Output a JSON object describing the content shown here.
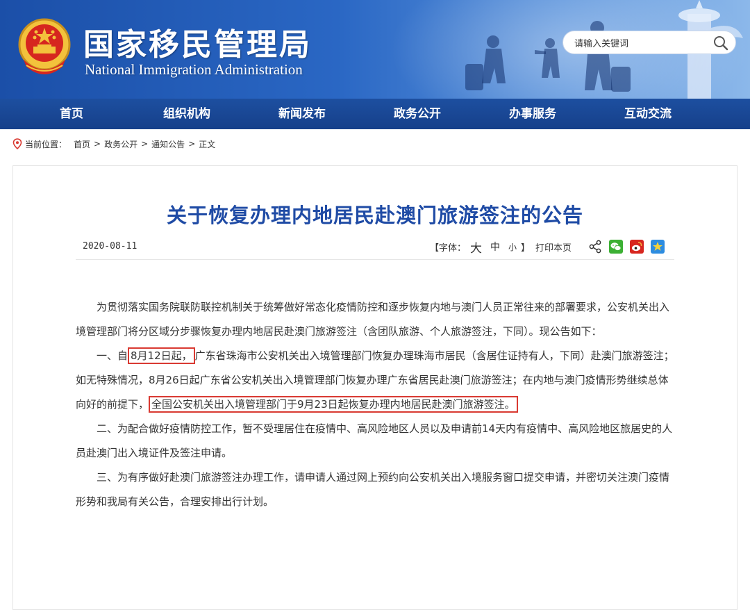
{
  "header": {
    "title": "国家移民管理局",
    "subtitle": "National Immigration Administration",
    "search_placeholder": "请输入关键词",
    "brand_color": "#1d4fa0",
    "emblem_icon": "national-emblem-icon"
  },
  "nav": {
    "items": [
      {
        "label": "首页"
      },
      {
        "label": "组织机构"
      },
      {
        "label": "新闻发布"
      },
      {
        "label": "政务公开"
      },
      {
        "label": "办事服务"
      },
      {
        "label": "互动交流"
      }
    ]
  },
  "breadcrumb": {
    "prefix": "当前位置：",
    "items": [
      {
        "label": "首页"
      },
      {
        "label": "政务公开"
      },
      {
        "label": "通知公告"
      },
      {
        "label": "正文"
      }
    ],
    "separator": ">"
  },
  "article": {
    "title": "关于恢复办理内地居民赴澳门旅游签注的公告",
    "date": "2020-08-11",
    "font_label_open": "【字体：",
    "font_big": "大",
    "font_mid": "中",
    "font_small": "小",
    "font_label_close": "】",
    "print_label": "打印本页",
    "share_icons": [
      "share-icon",
      "wechat-icon",
      "weibo-icon",
      "qzone-icon"
    ],
    "title_color": "#1f4ba5",
    "highlight_color": "#d93a32",
    "p1": "为贯彻落实国务院联防联控机制关于统筹做好常态化疫情防控和逐步恢复内地与澳门人员正常往来的部署要求，公安机关出入境管理部门将分区域分步骤恢复办理内地居民赴澳门旅游签注（含团队旅游、个人旅游签注，下同）。现公告如下：",
    "p2_a": "一、自",
    "p2_hl1": "8月12日起，",
    "p2_b": "广东省珠海市公安机关出入境管理部门恢复办理珠海市居民（含居住证持有人，下同）赴澳门旅游签注；如无特殊情况，8月26日起广东省公安机关出入境管理部门恢复办理广东省居民赴澳门旅游签注；在内地与澳门疫情形势继续总体向好的前提下，",
    "p2_hl2": "全国公安机关出入境管理部门于9月23日起恢复办理内地居民赴澳门旅游签注。",
    "p3": "二、为配合做好疫情防控工作，暂不受理居住在疫情中、高风险地区人员以及申请前14天内有疫情中、高风险地区旅居史的人员赴澳门出入境证件及签注申请。",
    "p4": "三、为有序做好赴澳门旅游签注办理工作，请申请人通过网上预约向公安机关出入境服务窗口提交申请，并密切关注澳门疫情形势和我局有关公告，合理安排出行计划。"
  }
}
